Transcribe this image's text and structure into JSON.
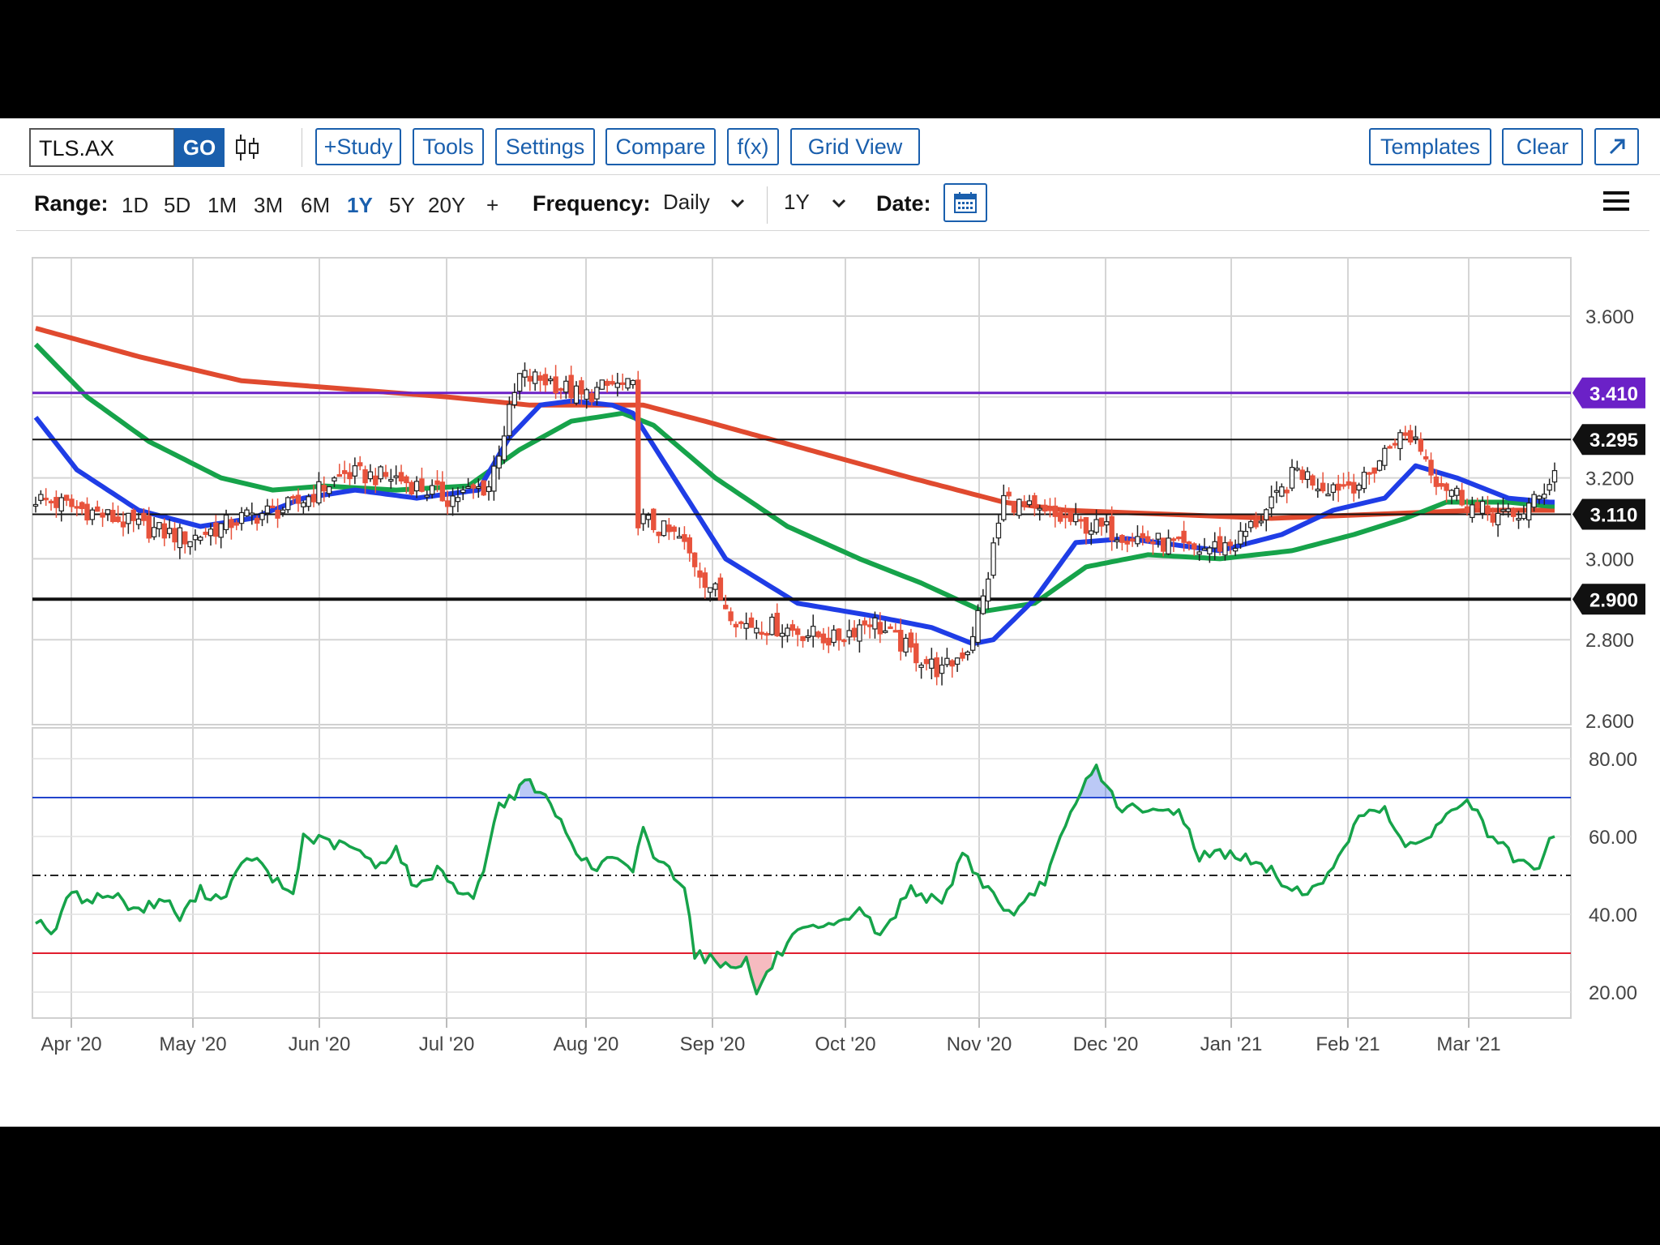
{
  "toolbar": {
    "symbol": "TLS.AX",
    "go_label": "GO",
    "buttons": [
      "+Study",
      "Tools",
      "Settings",
      "Compare",
      "f(x)",
      "Grid View"
    ],
    "templates_label": "Templates",
    "clear_label": "Clear",
    "popout_icon": "popout-arrow-icon",
    "chart_style_icon": "candlestick-icon"
  },
  "rangebar": {
    "range_label": "Range:",
    "ranges": [
      "1D",
      "5D",
      "1M",
      "3M",
      "6M",
      "1Y",
      "5Y",
      "20Y",
      "+"
    ],
    "active_range": "1Y",
    "frequency_label": "Frequency:",
    "frequency_value": "Daily",
    "period_value": "1Y",
    "date_label": "Date:",
    "calendar_icon": "calendar-icon",
    "menu_icon": "hamburger-menu-icon"
  },
  "colors": {
    "accent": "#1a5fad",
    "up_candle": "#ffffff",
    "down_candle": "#e8533c",
    "ma_blue": "#1f3de6",
    "ma_green": "#16a34a",
    "ma_red": "#e04a2f",
    "line_purple": "#6b21c7",
    "rsi_line": "#16a34a",
    "rsi_upper": "#2244cc",
    "rsi_lower": "#e11d2e"
  },
  "chart_data": [
    {
      "type": "candlestick",
      "title": "",
      "x_tick_labels": [
        "Apr '20",
        "May '20",
        "Jun '20",
        "Jul '20",
        "Aug '20",
        "Sep '20",
        "Oct '20",
        "Nov '20",
        "Dec '20",
        "Jan '21",
        "Feb '21",
        "Mar '21"
      ],
      "y_tick_labels": [
        "3.600",
        "3.200",
        "3.000",
        "2.800",
        "2.600"
      ],
      "ylim": [
        2.6,
        3.6
      ],
      "grid": true,
      "horizontal_lines": [
        {
          "value": 3.41,
          "label": "3.410",
          "color": "#6b21c7"
        },
        {
          "value": 3.295,
          "label": "3.295",
          "color": "#111111"
        },
        {
          "value": 3.11,
          "label": "3.110",
          "color": "#111111"
        },
        {
          "value": 2.9,
          "label": "2.900",
          "color": "#111111"
        }
      ],
      "close_anchors": [
        [
          0,
          3.15
        ],
        [
          10,
          3.12
        ],
        [
          20,
          3.08
        ],
        [
          30,
          3.05
        ],
        [
          40,
          3.1
        ],
        [
          50,
          3.13
        ],
        [
          60,
          3.21
        ],
        [
          70,
          3.2
        ],
        [
          80,
          3.15
        ],
        [
          88,
          3.18
        ],
        [
          94,
          3.45
        ],
        [
          100,
          3.44
        ],
        [
          106,
          3.4
        ],
        [
          112,
          3.43
        ],
        [
          116,
          3.42
        ],
        [
          117,
          3.1
        ],
        [
          125,
          3.05
        ],
        [
          130,
          2.95
        ],
        [
          137,
          2.84
        ],
        [
          145,
          2.83
        ],
        [
          155,
          2.8
        ],
        [
          162,
          2.85
        ],
        [
          170,
          2.77
        ],
        [
          176,
          2.72
        ],
        [
          181,
          2.78
        ],
        [
          184,
          2.9
        ],
        [
          188,
          3.15
        ],
        [
          195,
          3.11
        ],
        [
          205,
          3.08
        ],
        [
          215,
          3.05
        ],
        [
          225,
          3.02
        ],
        [
          233,
          3.04
        ],
        [
          240,
          3.13
        ],
        [
          245,
          3.22
        ],
        [
          250,
          3.18
        ],
        [
          258,
          3.19
        ],
        [
          264,
          3.3
        ],
        [
          268,
          3.3
        ],
        [
          272,
          3.2
        ],
        [
          280,
          3.12
        ],
        [
          287,
          3.1
        ],
        [
          292,
          3.15
        ],
        [
          295,
          3.22
        ]
      ],
      "ma_series": [
        {
          "color": "#1f3de6",
          "values": [
            [
              0,
              3.35
            ],
            [
              8,
              3.22
            ],
            [
              20,
              3.12
            ],
            [
              32,
              3.08
            ],
            [
              42,
              3.1
            ],
            [
              52,
              3.15
            ],
            [
              62,
              3.17
            ],
            [
              74,
              3.15
            ],
            [
              86,
              3.17
            ],
            [
              92,
              3.3
            ],
            [
              98,
              3.38
            ],
            [
              104,
              3.39
            ],
            [
              112,
              3.38
            ],
            [
              116,
              3.36
            ],
            [
              124,
              3.2
            ],
            [
              134,
              3.0
            ],
            [
              148,
              2.89
            ],
            [
              162,
              2.86
            ],
            [
              174,
              2.83
            ],
            [
              182,
              2.79
            ],
            [
              186,
              2.8
            ],
            [
              194,
              2.9
            ],
            [
              202,
              3.04
            ],
            [
              212,
              3.05
            ],
            [
              230,
              3.02
            ],
            [
              242,
              3.06
            ],
            [
              252,
              3.12
            ],
            [
              262,
              3.15
            ],
            [
              268,
              3.23
            ],
            [
              276,
              3.2
            ],
            [
              286,
              3.15
            ],
            [
              294,
              3.14
            ]
          ]
        },
        {
          "color": "#16a34a",
          "values": [
            [
              0,
              3.53
            ],
            [
              10,
              3.4
            ],
            [
              22,
              3.29
            ],
            [
              36,
              3.2
            ],
            [
              46,
              3.17
            ],
            [
              56,
              3.18
            ],
            [
              70,
              3.17
            ],
            [
              84,
              3.18
            ],
            [
              94,
              3.27
            ],
            [
              104,
              3.34
            ],
            [
              114,
              3.36
            ],
            [
              120,
              3.33
            ],
            [
              132,
              3.2
            ],
            [
              146,
              3.08
            ],
            [
              160,
              3.0
            ],
            [
              172,
              2.94
            ],
            [
              184,
              2.87
            ],
            [
              194,
              2.89
            ],
            [
              204,
              2.98
            ],
            [
              216,
              3.01
            ],
            [
              230,
              3.0
            ],
            [
              244,
              3.02
            ],
            [
              256,
              3.06
            ],
            [
              266,
              3.1
            ],
            [
              274,
              3.14
            ],
            [
              286,
              3.14
            ],
            [
              294,
              3.13
            ]
          ]
        },
        {
          "color": "#e04a2f",
          "values": [
            [
              0,
              3.57
            ],
            [
              20,
              3.5
            ],
            [
              40,
              3.44
            ],
            [
              60,
              3.42
            ],
            [
              80,
              3.4
            ],
            [
              96,
              3.38
            ],
            [
              118,
              3.38
            ],
            [
              130,
              3.34
            ],
            [
              150,
              3.27
            ],
            [
              170,
              3.2
            ],
            [
              188,
              3.14
            ],
            [
              200,
              3.12
            ],
            [
              220,
              3.11
            ],
            [
              240,
              3.1
            ],
            [
              260,
              3.11
            ],
            [
              280,
              3.12
            ],
            [
              294,
              3.12
            ]
          ]
        }
      ]
    },
    {
      "type": "line",
      "title": "",
      "y_tick_labels": [
        "80.00",
        "60.00",
        "40.00",
        "20.00"
      ],
      "ylim": [
        15,
        83
      ],
      "reference_lines": [
        {
          "value": 70,
          "color": "#2244cc"
        },
        {
          "value": 50,
          "style": "dash-dot"
        },
        {
          "value": 30,
          "color": "#e11d2e"
        }
      ],
      "rsi_anchors": [
        [
          0,
          39
        ],
        [
          4,
          35
        ],
        [
          6,
          45
        ],
        [
          10,
          44
        ],
        [
          15,
          45
        ],
        [
          20,
          41
        ],
        [
          25,
          44
        ],
        [
          28,
          39
        ],
        [
          32,
          46
        ],
        [
          36,
          44
        ],
        [
          40,
          52
        ],
        [
          42,
          55
        ],
        [
          46,
          49
        ],
        [
          50,
          45
        ],
        [
          52,
          60
        ],
        [
          58,
          58
        ],
        [
          62,
          57
        ],
        [
          66,
          52
        ],
        [
          70,
          57
        ],
        [
          74,
          46
        ],
        [
          78,
          52
        ],
        [
          84,
          44
        ],
        [
          86,
          47
        ],
        [
          90,
          68
        ],
        [
          94,
          72
        ],
        [
          96,
          74
        ],
        [
          100,
          68
        ],
        [
          104,
          59
        ],
        [
          108,
          51
        ],
        [
          112,
          55
        ],
        [
          116,
          50
        ],
        [
          118,
          63
        ],
        [
          120,
          55
        ],
        [
          126,
          48
        ],
        [
          128,
          30
        ],
        [
          134,
          27
        ],
        [
          138,
          28
        ],
        [
          140,
          20
        ],
        [
          144,
          29
        ],
        [
          148,
          35
        ],
        [
          156,
          37
        ],
        [
          160,
          42
        ],
        [
          164,
          34
        ],
        [
          170,
          47
        ],
        [
          176,
          42
        ],
        [
          180,
          56
        ],
        [
          184,
          48
        ],
        [
          190,
          39
        ],
        [
          196,
          49
        ],
        [
          200,
          62
        ],
        [
          204,
          74
        ],
        [
          206,
          78
        ],
        [
          210,
          68
        ],
        [
          216,
          66
        ],
        [
          222,
          67
        ],
        [
          226,
          55
        ],
        [
          232,
          56
        ],
        [
          240,
          51
        ],
        [
          244,
          46
        ],
        [
          250,
          47
        ],
        [
          254,
          58
        ],
        [
          258,
          66
        ],
        [
          262,
          68
        ],
        [
          266,
          56
        ],
        [
          270,
          60
        ],
        [
          278,
          70
        ],
        [
          282,
          61
        ],
        [
          288,
          53
        ],
        [
          292,
          51
        ],
        [
          294,
          59
        ]
      ]
    }
  ]
}
